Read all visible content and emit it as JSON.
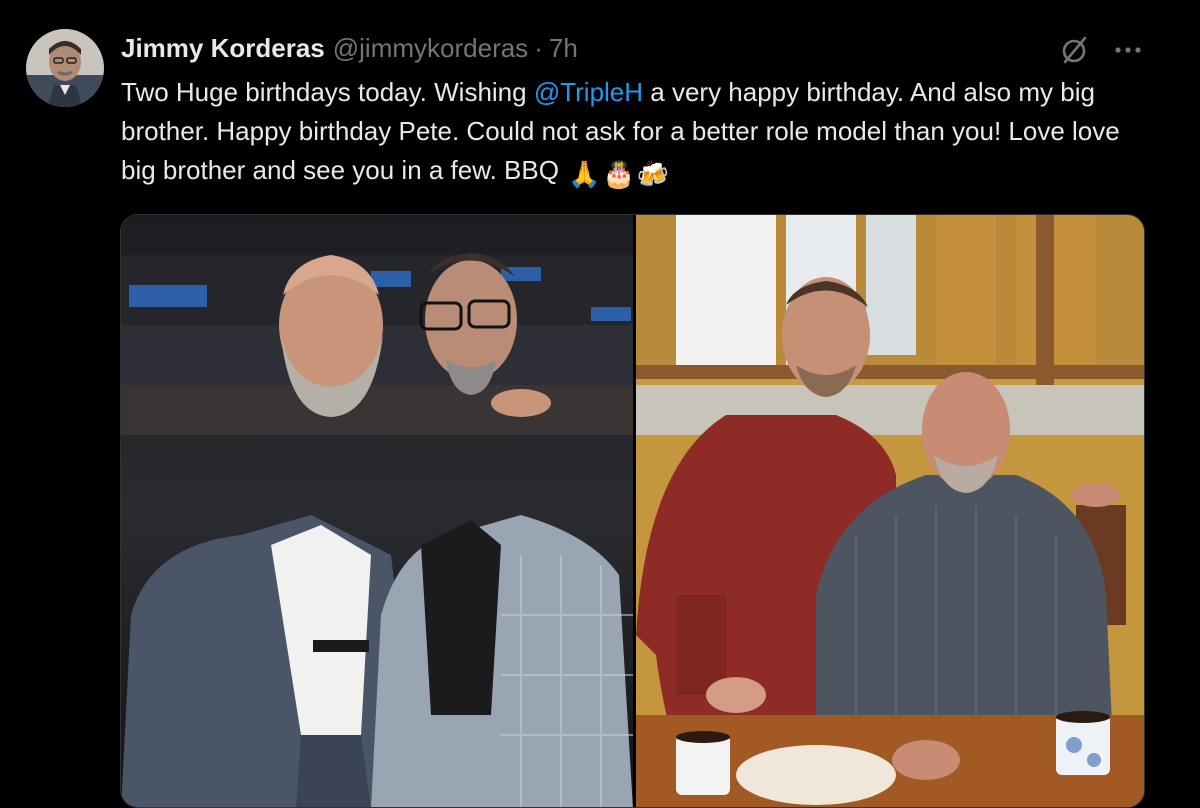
{
  "author": {
    "display_name": "Jimmy Korderas",
    "handle": "@jimmykorderas",
    "separator": "·",
    "time": "7h",
    "avatar_icon": "avatar"
  },
  "tweet": {
    "text_before": "Two Huge birthdays today. Wishing ",
    "mention": "@TripleH",
    "text_after": " a very happy birthday. And also my big brother. Happy birthday Pete. Could not ask for a better role model than you! Love love big brother and see you in a few. BBQ ",
    "emojis": [
      "🙏",
      "🎂",
      "🍻"
    ]
  },
  "actions": {
    "grok_icon": "grok-icon",
    "more_icon": "more-icon"
  },
  "media": {
    "left_photo": "arena-photo",
    "right_photo": "kitchen-photo"
  },
  "colors": {
    "background": "#000000",
    "text": "#e7e9ea",
    "secondary": "#71767b",
    "link": "#1d9bf0",
    "border": "#2f3336"
  }
}
